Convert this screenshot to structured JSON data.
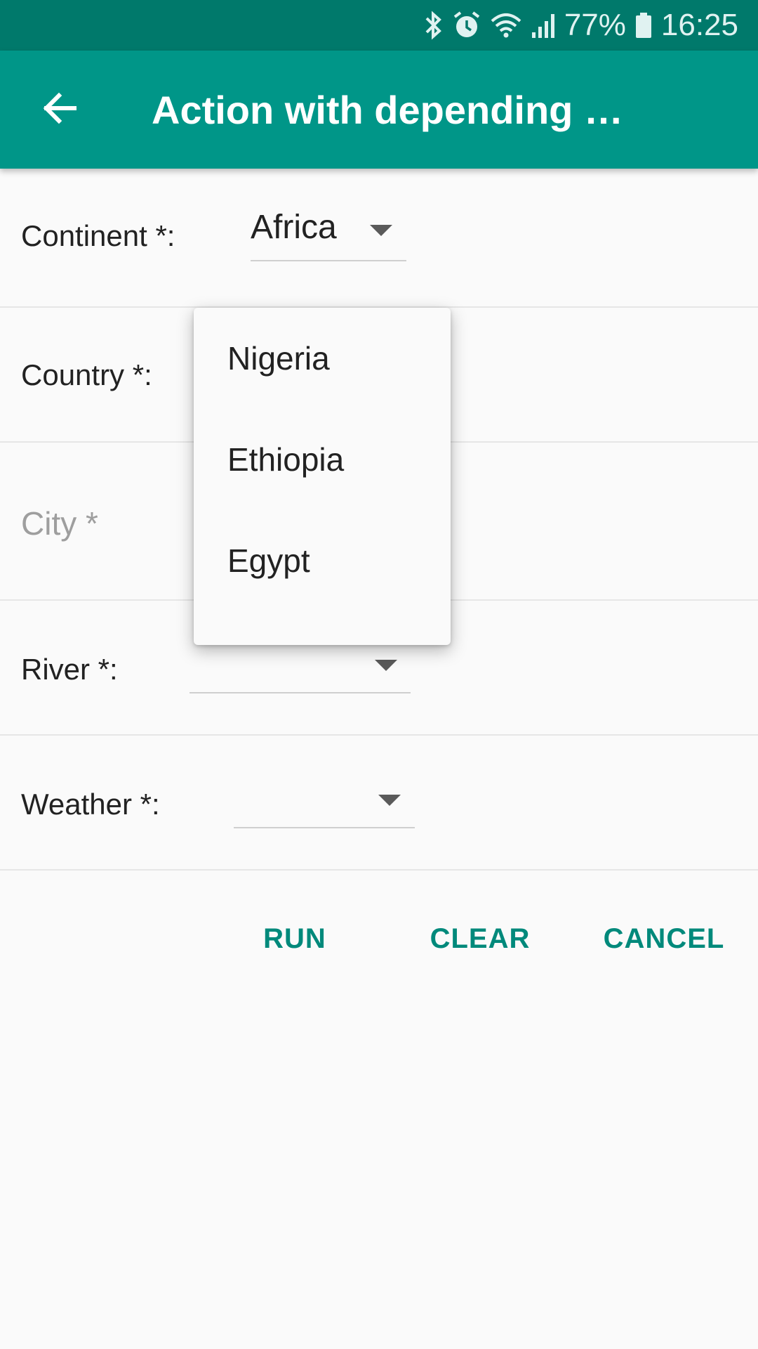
{
  "status_bar": {
    "battery": "77%",
    "time": "16:25",
    "icons": [
      "bluetooth-icon",
      "alarm-icon",
      "wifi-icon",
      "signal-icon",
      "battery-icon"
    ]
  },
  "app_bar": {
    "title": "Action with depending …",
    "back_icon": "arrow-back-icon"
  },
  "form": {
    "continent": {
      "label": "Continent *:",
      "value": "Africa"
    },
    "country": {
      "label": "Country *:",
      "value": ""
    },
    "city": {
      "placeholder": "City *"
    },
    "river": {
      "label": "River *:",
      "value": ""
    },
    "weather": {
      "label": "Weather *:",
      "value": ""
    }
  },
  "dropdown": {
    "options": [
      "Nigeria",
      "Ethiopia",
      "Egypt"
    ]
  },
  "buttons": {
    "run": "RUN",
    "clear": "CLEAR",
    "cancel": "CANCEL"
  },
  "colors": {
    "status_bar": "#00796b",
    "app_bar": "#009688",
    "accent": "#00897b",
    "background": "#fafafa"
  }
}
